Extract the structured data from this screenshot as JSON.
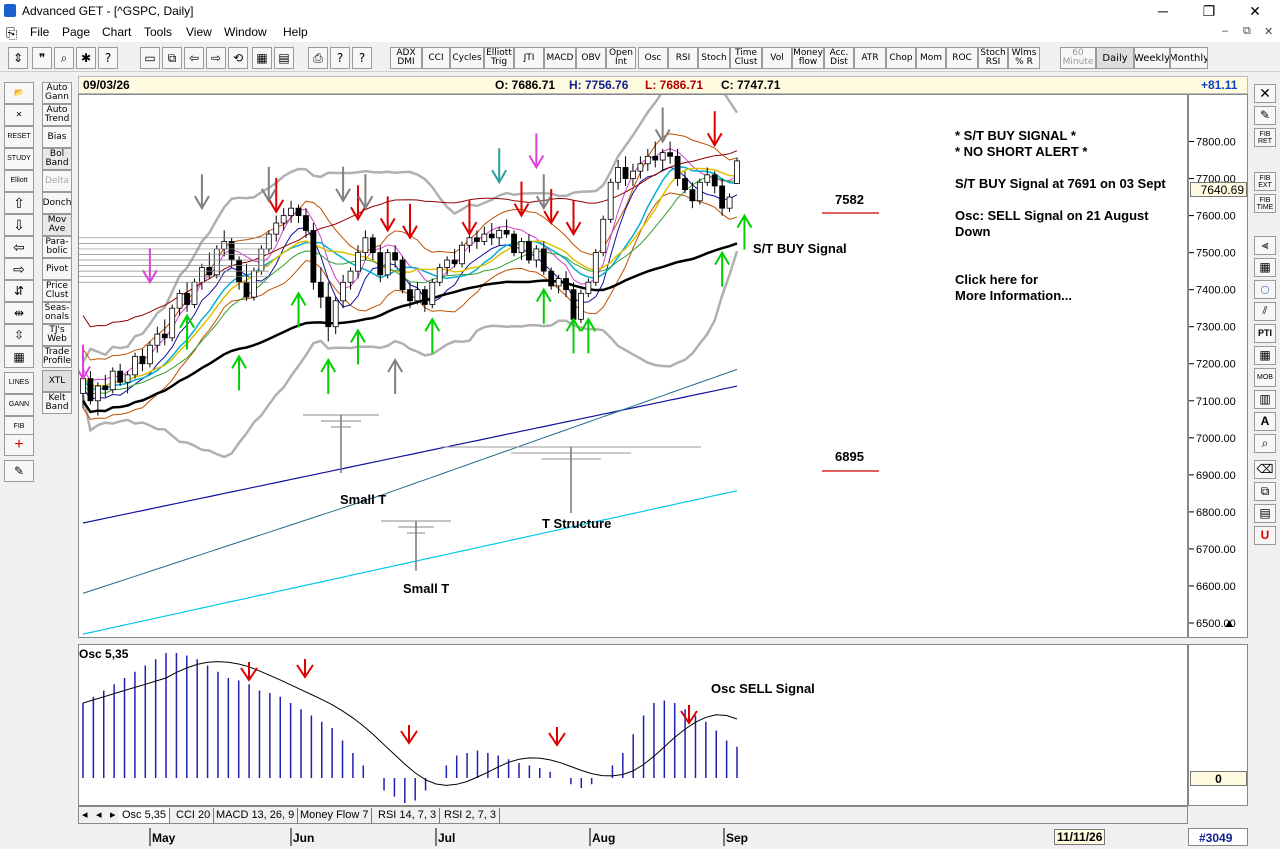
{
  "window": {
    "title": "Advanced GET - [^GSPC, Daily]",
    "min": "─",
    "max": "❐",
    "close": "✕"
  },
  "menu": [
    "File",
    "Page",
    "Chart",
    "Tools",
    "View",
    "Window",
    "Help"
  ],
  "mdi_controls": [
    "–",
    "⧉",
    "✕"
  ],
  "toolbar": {
    "indicators": [
      "ADX DMI",
      "CCI",
      "Cycles",
      "Elliott Trig",
      "JTI",
      "MACD",
      "OBV",
      "Open Int",
      "Osc",
      "RSI",
      "Stoch",
      "Time Clust",
      "Vol",
      "Money flow",
      "Acc. Dist",
      "ATR",
      "Chop",
      "Mom",
      "ROC",
      "Stoch RSI",
      "Wlms % R"
    ],
    "periods": [
      "60 Minute",
      "Daily",
      "Weekly",
      "Monthly"
    ],
    "selected_period": "Daily"
  },
  "left_tools": [
    "Auto Gann",
    "Auto Trend",
    "Bias",
    "Bol Band",
    "Delta",
    "Donch",
    "Mov Ave",
    "Para-bolic",
    "Pivot",
    "Price Clust",
    "Seas-onals",
    "TJ's Web",
    "Trade Profile",
    "XTL",
    "Kelt Band"
  ],
  "left_icons": [
    "RESET",
    "STUDY",
    "Elliott",
    "LINES",
    "GANN",
    "FIB"
  ],
  "right_tools": [
    "FIB RET",
    "FIB EXT",
    "FIB TIME",
    "PTI",
    "MOB"
  ],
  "infobar": {
    "date": "09/03/26",
    "open": "O: 7686.71",
    "high": "H: 7756.76",
    "low": "L: 7686.71",
    "close": "C: 7747.71",
    "change": "+81.11"
  },
  "annotations": {
    "st_buy_signal": "* S/T BUY SIGNAL *",
    "no_short_alert": "* NO SHORT ALERT *",
    "buy_detail": "S/T BUY Signal at 7691 on 03 Sept",
    "osc_detail_1": "Osc: SELL Signal on 21 August",
    "osc_detail_2": "Down",
    "click_here_1": "Click here for",
    "click_here_2": "More Information...",
    "level_upper": "7582",
    "level_lower": "6895",
    "st_buy_label": "S/T BUY Signal",
    "small_t_1": "Small T",
    "small_t_2": "Small T",
    "t_structure": "T Structure",
    "osc_sell_label": "Osc SELL Signal",
    "osc_title": "Osc 5,35"
  },
  "price_axis": {
    "current": "7640.69",
    "zero": "0"
  },
  "tabs": [
    "Osc 5,35",
    "CCI 20",
    "MACD 13, 26, 9",
    "Money Flow 7",
    "RSI 14, 7, 3",
    "RSI 2, 7, 3"
  ],
  "active_tab": "Osc 5,35",
  "date_axis": [
    "May",
    "Jun",
    "Jul",
    "Aug",
    "Sep"
  ],
  "bottom_date": "11/11/26",
  "bar_count": "#3049",
  "colors": {
    "bull": "#ffffff",
    "bear": "#000000",
    "sma_long": "#000000",
    "blue_ma": "#1010a0",
    "cyan_ma": "#00c8e8",
    "buy_arrow": "#00d000",
    "sell_arrow": "#dd0000",
    "gray_arrow": "#808080",
    "magenta_arrow": "#e040e0",
    "osc_bar": "#2020b0"
  },
  "chart_data": {
    "type": "candlestick",
    "symbol": "^GSPC",
    "interval": "Daily",
    "ylim": [
      6500,
      7850
    ],
    "y_ticks": [
      "7800.00",
      "7700.00",
      "7600.00",
      "7500.00",
      "7400.00",
      "7300.00",
      "7200.00",
      "7100.00",
      "7000.00",
      "6900.00",
      "6800.00",
      "6700.00",
      "6600.00",
      "6500.00"
    ],
    "x_labels": [
      "May",
      "Jun",
      "Jul",
      "Aug",
      "Sep"
    ],
    "candles": [
      [
        7120,
        7170,
        7080,
        7160
      ],
      [
        7160,
        7180,
        7090,
        7100
      ],
      [
        7100,
        7150,
        7060,
        7140
      ],
      [
        7140,
        7170,
        7110,
        7130
      ],
      [
        7130,
        7190,
        7120,
        7180
      ],
      [
        7180,
        7200,
        7140,
        7150
      ],
      [
        7150,
        7180,
        7120,
        7170
      ],
      [
        7170,
        7230,
        7160,
        7220
      ],
      [
        7220,
        7240,
        7180,
        7200
      ],
      [
        7200,
        7260,
        7190,
        7250
      ],
      [
        7250,
        7300,
        7230,
        7280
      ],
      [
        7280,
        7320,
        7250,
        7270
      ],
      [
        7270,
        7360,
        7260,
        7350
      ],
      [
        7350,
        7400,
        7330,
        7390
      ],
      [
        7390,
        7420,
        7340,
        7360
      ],
      [
        7360,
        7430,
        7350,
        7420
      ],
      [
        7420,
        7470,
        7400,
        7460
      ],
      [
        7460,
        7500,
        7430,
        7440
      ],
      [
        7440,
        7520,
        7430,
        7510
      ],
      [
        7510,
        7560,
        7490,
        7530
      ],
      [
        7530,
        7540,
        7460,
        7480
      ],
      [
        7480,
        7490,
        7400,
        7420
      ],
      [
        7420,
        7470,
        7370,
        7380
      ],
      [
        7380,
        7460,
        7370,
        7450
      ],
      [
        7450,
        7520,
        7440,
        7510
      ],
      [
        7510,
        7560,
        7500,
        7550
      ],
      [
        7550,
        7600,
        7530,
        7580
      ],
      [
        7580,
        7620,
        7560,
        7600
      ],
      [
        7600,
        7640,
        7580,
        7620
      ],
      [
        7620,
        7630,
        7580,
        7600
      ],
      [
        7600,
        7620,
        7540,
        7560
      ],
      [
        7560,
        7580,
        7400,
        7420
      ],
      [
        7420,
        7460,
        7350,
        7380
      ],
      [
        7380,
        7420,
        7260,
        7300
      ],
      [
        7300,
        7380,
        7280,
        7370
      ],
      [
        7370,
        7440,
        7350,
        7420
      ],
      [
        7420,
        7460,
        7400,
        7450
      ],
      [
        7450,
        7520,
        7430,
        7500
      ],
      [
        7500,
        7560,
        7480,
        7540
      ],
      [
        7540,
        7550,
        7480,
        7500
      ],
      [
        7500,
        7520,
        7420,
        7440
      ],
      [
        7440,
        7510,
        7430,
        7500
      ],
      [
        7500,
        7520,
        7460,
        7480
      ],
      [
        7480,
        7490,
        7390,
        7400
      ],
      [
        7400,
        7420,
        7350,
        7370
      ],
      [
        7370,
        7420,
        7360,
        7400
      ],
      [
        7400,
        7410,
        7340,
        7360
      ],
      [
        7360,
        7430,
        7350,
        7420
      ],
      [
        7420,
        7470,
        7410,
        7460
      ],
      [
        7460,
        7490,
        7440,
        7480
      ],
      [
        7480,
        7510,
        7460,
        7470
      ],
      [
        7470,
        7530,
        7460,
        7520
      ],
      [
        7520,
        7550,
        7500,
        7540
      ],
      [
        7540,
        7560,
        7510,
        7530
      ],
      [
        7530,
        7570,
        7520,
        7550
      ],
      [
        7550,
        7580,
        7520,
        7540
      ],
      [
        7540,
        7570,
        7520,
        7560
      ],
      [
        7560,
        7590,
        7540,
        7550
      ],
      [
        7550,
        7560,
        7490,
        7500
      ],
      [
        7500,
        7540,
        7480,
        7530
      ],
      [
        7530,
        7550,
        7470,
        7480
      ],
      [
        7480,
        7520,
        7460,
        7510
      ],
      [
        7510,
        7530,
        7440,
        7450
      ],
      [
        7450,
        7460,
        7400,
        7410
      ],
      [
        7410,
        7440,
        7390,
        7430
      ],
      [
        7430,
        7450,
        7380,
        7400
      ],
      [
        7400,
        7420,
        7300,
        7320
      ],
      [
        7320,
        7400,
        7310,
        7390
      ],
      [
        7390,
        7430,
        7380,
        7420
      ],
      [
        7420,
        7510,
        7410,
        7500
      ],
      [
        7500,
        7600,
        7490,
        7590
      ],
      [
        7590,
        7700,
        7580,
        7690
      ],
      [
        7690,
        7750,
        7670,
        7730
      ],
      [
        7730,
        7760,
        7680,
        7700
      ],
      [
        7700,
        7740,
        7680,
        7720
      ],
      [
        7720,
        7760,
        7700,
        7740
      ],
      [
        7740,
        7780,
        7720,
        7760
      ],
      [
        7760,
        7800,
        7730,
        7750
      ],
      [
        7750,
        7780,
        7720,
        7770
      ],
      [
        7770,
        7800,
        7740,
        7760
      ],
      [
        7760,
        7780,
        7680,
        7700
      ],
      [
        7700,
        7720,
        7660,
        7670
      ],
      [
        7670,
        7690,
        7620,
        7640
      ],
      [
        7640,
        7700,
        7630,
        7690
      ],
      [
        7690,
        7730,
        7680,
        7710
      ],
      [
        7710,
        7720,
        7660,
        7680
      ],
      [
        7680,
        7700,
        7600,
        7620
      ],
      [
        7620,
        7660,
        7610,
        7650
      ],
      [
        7686.71,
        7756.76,
        7686.71,
        7747.71
      ]
    ],
    "osc_values": [
      0.6,
      0.65,
      0.7,
      0.75,
      0.8,
      0.85,
      0.9,
      0.95,
      1.0,
      1.0,
      0.98,
      0.95,
      0.9,
      0.85,
      0.8,
      0.78,
      0.75,
      0.7,
      0.68,
      0.65,
      0.6,
      0.55,
      0.5,
      0.45,
      0.4,
      0.3,
      0.2,
      0.1,
      0.0,
      -0.1,
      -0.15,
      -0.2,
      -0.18,
      -0.1,
      0.0,
      0.1,
      0.18,
      0.2,
      0.22,
      0.2,
      0.18,
      0.15,
      0.12,
      0.1,
      0.08,
      0.05,
      0.0,
      -0.05,
      -0.08,
      -0.05,
      0.0,
      0.1,
      0.2,
      0.35,
      0.5,
      0.6,
      0.62,
      0.6,
      0.55,
      0.5,
      0.45,
      0.38,
      0.3,
      0.25
    ]
  }
}
